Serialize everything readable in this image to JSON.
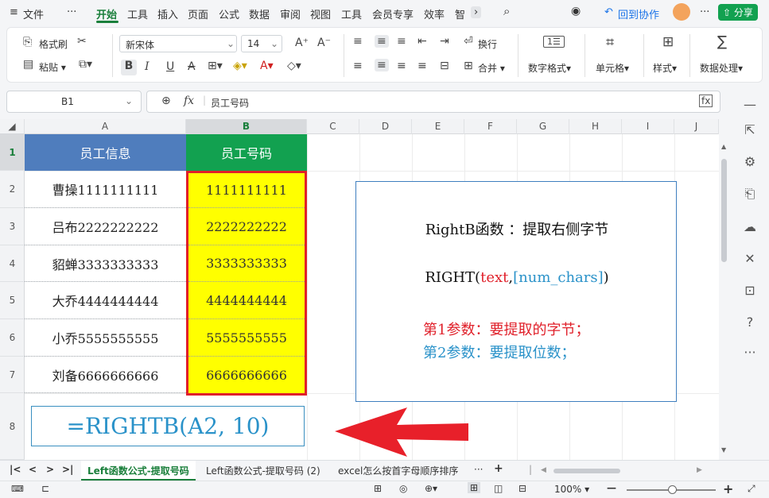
{
  "menubar": {
    "menu_icon": "≡",
    "file_label": "文件",
    "more_label": "···",
    "tabs": [
      "开始",
      "工具",
      "插入",
      "页面",
      "公式",
      "数据",
      "审阅",
      "视图",
      "工具",
      "会员专享",
      "效率",
      "智"
    ],
    "back_collab": "回到协作",
    "share": "分享"
  },
  "ribbon": {
    "format_painter": "格式刷",
    "paste": "粘贴",
    "font_name": "新宋体",
    "font_size": "14",
    "wrap": "换行",
    "merge": "合并",
    "number_format": "数字格式",
    "cell": "单元格",
    "style": "样式",
    "data_process": "数据处理",
    "bold": "B",
    "italic": "I",
    "underline": "U",
    "strike": "A",
    "grow": "A⁺",
    "shrink": "A⁻"
  },
  "formula_bar": {
    "name_box": "B1",
    "fx": "fx",
    "content": "员工号码"
  },
  "columns": [
    "A",
    "B",
    "C",
    "D",
    "E",
    "F",
    "G",
    "H",
    "I",
    "J"
  ],
  "rows": [
    "1",
    "2",
    "3",
    "4",
    "5",
    "6",
    "7",
    "8"
  ],
  "table": {
    "header_a": "员工信息",
    "header_b": "员工号码",
    "col_a": [
      "曹操1111111111",
      "吕布2222222222",
      "貂蝉3333333333",
      "大乔4444444444",
      "小乔5555555555",
      "刘备6666666666"
    ],
    "col_b": [
      "1111111111",
      "2222222222",
      "3333333333",
      "4444444444",
      "5555555555",
      "6666666666"
    ]
  },
  "formula_box": "=RIGHTB(A2, 10)",
  "info_box": {
    "title": "RightB函数 ：提取右侧字节",
    "syntax_fn": "RIGHT(",
    "syntax_p1": "text",
    "syntax_sep": ",",
    "syntax_p2": "[num_chars]",
    "syntax_close": ")",
    "param1": "第1参数：要提取的字节；",
    "param2": "第2参数：要提取位数；"
  },
  "sheet_tabs": {
    "active": "Left函数公式-提取号码",
    "tab2": "Left函数公式-提取号码 (2)",
    "tab3": "excel怎么按首字母顺序排序",
    "more": "···",
    "add": "+"
  },
  "status": {
    "zoom": "100%"
  },
  "colors": {
    "green": "#1a7f3b",
    "header_blue": "#4f7dbd",
    "header_green": "#12a150",
    "yellow": "#ffff00",
    "red_border": "#e0202a",
    "formula_blue": "#2a92c9"
  }
}
